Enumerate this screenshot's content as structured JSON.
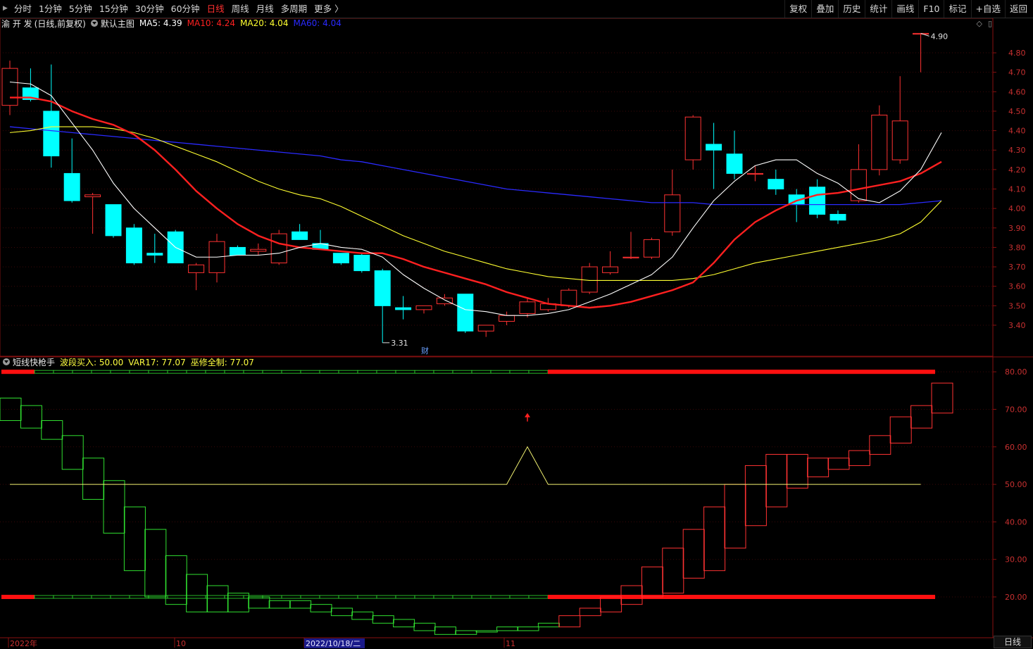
{
  "toolbar": {
    "left": [
      "分时",
      "1分钟",
      "5分钟",
      "15分钟",
      "30分钟",
      "60分钟",
      "日线",
      "周线",
      "月线",
      "多周期",
      "更多 〉"
    ],
    "active": "日线",
    "right": [
      "复权",
      "叠加",
      "历史",
      "统计",
      "画线",
      "F10",
      "标记",
      "+自选",
      "返回"
    ]
  },
  "main_panel": {
    "stock_name": "渝 开 发",
    "mode": "(日线,前复权)",
    "template": "默认主图",
    "ma": [
      {
        "label": "MA5: 4.39",
        "color": "#ffffff"
      },
      {
        "label": "MA10: 4.24",
        "color": "#ff2020"
      },
      {
        "label": "MA20: 4.04",
        "color": "#ffff30"
      },
      {
        "label": "MA60: 4.04",
        "color": "#2a2aff"
      }
    ],
    "high_marker": "4.90",
    "low_marker": "3.31",
    "event_tag": "财",
    "y_ticks": [
      "4.80",
      "4.70",
      "4.60",
      "4.50",
      "4.40",
      "4.30",
      "4.20",
      "4.10",
      "4.00",
      "3.90",
      "3.80",
      "3.70",
      "3.60",
      "3.50",
      "3.40"
    ]
  },
  "sub_panel": {
    "indicator": "短线快枪手",
    "values": [
      {
        "label": "波段买入: 50.00",
        "color": "#ffff40"
      },
      {
        "label": "VAR17: 77.07",
        "color": "#ffff40"
      },
      {
        "label": "巫修全制: 77.07",
        "color": "#ffff40"
      }
    ],
    "y_ticks": [
      "80.00",
      "70.00",
      "60.00",
      "50.00",
      "40.00",
      "30.00",
      "20.00"
    ]
  },
  "x_axis": {
    "labels": [
      "2022年",
      "10",
      "2022/10/18/二",
      "11"
    ],
    "period": "日线"
  },
  "chart_data": {
    "type": "candlestick",
    "candles": [
      {
        "o": 4.53,
        "h": 4.76,
        "l": 4.48,
        "c": 4.72
      },
      {
        "o": 4.62,
        "h": 4.72,
        "l": 4.55,
        "c": 4.56
      },
      {
        "o": 4.5,
        "h": 4.74,
        "l": 4.21,
        "c": 4.27
      },
      {
        "o": 4.18,
        "h": 4.36,
        "l": 4.03,
        "c": 4.04
      },
      {
        "o": 4.06,
        "h": 4.08,
        "l": 3.87,
        "c": 4.07
      },
      {
        "o": 4.02,
        "h": 4.02,
        "l": 3.85,
        "c": 3.86
      },
      {
        "o": 3.9,
        "h": 3.92,
        "l": 3.71,
        "c": 3.72
      },
      {
        "o": 3.77,
        "h": 3.87,
        "l": 3.72,
        "c": 3.76
      },
      {
        "o": 3.88,
        "h": 3.89,
        "l": 3.72,
        "c": 3.72
      },
      {
        "o": 3.67,
        "h": 3.72,
        "l": 3.58,
        "c": 3.71
      },
      {
        "o": 3.67,
        "h": 3.87,
        "l": 3.62,
        "c": 3.83
      },
      {
        "o": 3.8,
        "h": 3.81,
        "l": 3.76,
        "c": 3.76
      },
      {
        "o": 3.78,
        "h": 3.82,
        "l": 3.76,
        "c": 3.79
      },
      {
        "o": 3.72,
        "h": 3.89,
        "l": 3.71,
        "c": 3.87
      },
      {
        "o": 3.88,
        "h": 3.92,
        "l": 3.84,
        "c": 3.84
      },
      {
        "o": 3.82,
        "h": 3.89,
        "l": 3.79,
        "c": 3.79
      },
      {
        "o": 3.77,
        "h": 3.77,
        "l": 3.71,
        "c": 3.72
      },
      {
        "o": 3.76,
        "h": 3.77,
        "l": 3.67,
        "c": 3.68
      },
      {
        "o": 3.68,
        "h": 3.69,
        "l": 3.31,
        "c": 3.5
      },
      {
        "o": 3.49,
        "h": 3.55,
        "l": 3.43,
        "c": 3.48
      },
      {
        "o": 3.48,
        "h": 3.5,
        "l": 3.46,
        "c": 3.5
      },
      {
        "o": 3.51,
        "h": 3.56,
        "l": 3.5,
        "c": 3.54
      },
      {
        "o": 3.56,
        "h": 3.56,
        "l": 3.36,
        "c": 3.37
      },
      {
        "o": 3.37,
        "h": 3.4,
        "l": 3.34,
        "c": 3.4
      },
      {
        "o": 3.42,
        "h": 3.47,
        "l": 3.4,
        "c": 3.45
      },
      {
        "o": 3.46,
        "h": 3.54,
        "l": 3.44,
        "c": 3.52
      },
      {
        "o": 3.48,
        "h": 3.54,
        "l": 3.47,
        "c": 3.51
      },
      {
        "o": 3.5,
        "h": 3.59,
        "l": 3.49,
        "c": 3.58
      },
      {
        "o": 3.57,
        "h": 3.72,
        "l": 3.56,
        "c": 3.7
      },
      {
        "o": 3.67,
        "h": 3.78,
        "l": 3.66,
        "c": 3.7
      },
      {
        "o": 3.75,
        "h": 3.88,
        "l": 3.74,
        "c": 3.75
      },
      {
        "o": 3.75,
        "h": 3.85,
        "l": 3.74,
        "c": 3.84
      },
      {
        "o": 3.88,
        "h": 4.2,
        "l": 3.86,
        "c": 4.07
      },
      {
        "o": 4.25,
        "h": 4.48,
        "l": 4.2,
        "c": 4.47
      },
      {
        "o": 4.33,
        "h": 4.44,
        "l": 4.1,
        "c": 4.3
      },
      {
        "o": 4.28,
        "h": 4.4,
        "l": 4.15,
        "c": 4.18
      },
      {
        "o": 4.18,
        "h": 4.22,
        "l": 4.14,
        "c": 4.18
      },
      {
        "o": 4.15,
        "h": 4.2,
        "l": 4.07,
        "c": 4.1
      },
      {
        "o": 4.07,
        "h": 4.1,
        "l": 3.93,
        "c": 4.02
      },
      {
        "o": 4.11,
        "h": 4.15,
        "l": 3.95,
        "c": 3.97
      },
      {
        "o": 3.97,
        "h": 3.99,
        "l": 3.92,
        "c": 3.94
      },
      {
        "o": 4.04,
        "h": 4.33,
        "l": 4.03,
        "c": 4.2
      },
      {
        "o": 4.2,
        "h": 4.53,
        "l": 4.17,
        "c": 4.48
      },
      {
        "o": 4.25,
        "h": 4.68,
        "l": 4.23,
        "c": 4.45
      },
      {
        "o": 4.9,
        "h": 4.9,
        "l": 4.7,
        "c": 4.9
      }
    ],
    "ma5": [
      4.65,
      4.64,
      4.58,
      4.44,
      4.3,
      4.13,
      4.0,
      3.9,
      3.8,
      3.75,
      3.75,
      3.76,
      3.76,
      3.77,
      3.8,
      3.82,
      3.8,
      3.79,
      3.75,
      3.66,
      3.59,
      3.53,
      3.48,
      3.47,
      3.45,
      3.45,
      3.46,
      3.48,
      3.52,
      3.56,
      3.61,
      3.66,
      3.75,
      3.9,
      4.04,
      4.14,
      4.22,
      4.25,
      4.25,
      4.18,
      4.13,
      4.05,
      4.03,
      4.09,
      4.2,
      4.39
    ],
    "ma10": [
      4.57,
      4.57,
      4.55,
      4.5,
      4.46,
      4.43,
      4.38,
      4.3,
      4.2,
      4.09,
      4.0,
      3.92,
      3.86,
      3.82,
      3.8,
      3.79,
      3.78,
      3.77,
      3.77,
      3.74,
      3.7,
      3.67,
      3.64,
      3.61,
      3.57,
      3.54,
      3.51,
      3.5,
      3.49,
      3.5,
      3.52,
      3.55,
      3.58,
      3.62,
      3.72,
      3.84,
      3.93,
      3.99,
      4.04,
      4.07,
      4.08,
      4.1,
      4.12,
      4.14,
      4.18,
      4.24
    ],
    "ma20": [
      4.39,
      4.4,
      4.42,
      4.42,
      4.42,
      4.41,
      4.39,
      4.36,
      4.32,
      4.28,
      4.24,
      4.19,
      4.14,
      4.1,
      4.07,
      4.05,
      4.01,
      3.96,
      3.91,
      3.86,
      3.82,
      3.78,
      3.75,
      3.72,
      3.69,
      3.67,
      3.65,
      3.64,
      3.63,
      3.63,
      3.63,
      3.63,
      3.63,
      3.64,
      3.66,
      3.69,
      3.72,
      3.74,
      3.76,
      3.78,
      3.8,
      3.82,
      3.84,
      3.87,
      3.93,
      4.04
    ],
    "ma60": [
      4.42,
      4.41,
      4.4,
      4.39,
      4.38,
      4.37,
      4.36,
      4.35,
      4.34,
      4.33,
      4.32,
      4.31,
      4.3,
      4.29,
      4.28,
      4.27,
      4.25,
      4.24,
      4.22,
      4.2,
      4.18,
      4.16,
      4.14,
      4.12,
      4.1,
      4.09,
      4.08,
      4.07,
      4.06,
      4.05,
      4.04,
      4.03,
      4.03,
      4.03,
      4.02,
      4.02,
      4.02,
      4.02,
      4.02,
      4.02,
      4.02,
      4.02,
      4.02,
      4.02,
      4.03,
      4.04
    ],
    "sub_boxes": [
      {
        "a": 73,
        "b": 67
      },
      {
        "a": 71,
        "b": 65
      },
      {
        "a": 67,
        "b": 62
      },
      {
        "a": 63,
        "b": 54
      },
      {
        "a": 57,
        "b": 46
      },
      {
        "a": 51,
        "b": 37
      },
      {
        "a": 44,
        "b": 27
      },
      {
        "a": 38,
        "b": 20
      },
      {
        "a": 31,
        "b": 18
      },
      {
        "a": 26,
        "b": 16
      },
      {
        "a": 23,
        "b": 16
      },
      {
        "a": 21,
        "b": 16
      },
      {
        "a": 20,
        "b": 17
      },
      {
        "a": 19,
        "b": 17
      },
      {
        "a": 19,
        "b": 17
      },
      {
        "a": 18,
        "b": 16
      },
      {
        "a": 17,
        "b": 15
      },
      {
        "a": 16,
        "b": 14
      },
      {
        "a": 15,
        "b": 13
      },
      {
        "a": 14,
        "b": 12
      },
      {
        "a": 13,
        "b": 11
      },
      {
        "a": 12,
        "b": 10
      },
      {
        "a": 11,
        "b": 10
      },
      {
        "a": 11,
        "b": 11
      },
      {
        "a": 12,
        "b": 11
      },
      {
        "a": 12,
        "b": 11
      },
      {
        "a": 13,
        "b": 12
      },
      {
        "a": 15,
        "b": 12
      },
      {
        "a": 17,
        "b": 15
      },
      {
        "a": 20,
        "b": 16
      },
      {
        "a": 23,
        "b": 18
      },
      {
        "a": 28,
        "b": 20
      },
      {
        "a": 33,
        "b": 21
      },
      {
        "a": 38,
        "b": 25
      },
      {
        "a": 44,
        "b": 27
      },
      {
        "a": 50,
        "b": 33
      },
      {
        "a": 55,
        "b": 39
      },
      {
        "a": 58,
        "b": 44
      },
      {
        "a": 58,
        "b": 49
      },
      {
        "a": 57,
        "b": 52
      },
      {
        "a": 57,
        "b": 54
      },
      {
        "a": 59,
        "b": 55
      },
      {
        "a": 63,
        "b": 58
      },
      {
        "a": 68,
        "b": 61
      },
      {
        "a": 71,
        "b": 65
      },
      {
        "a": 77,
        "b": 69
      }
    ],
    "buy_line": {
      "base": 50.0,
      "peak_index": 25,
      "peak": 60.0
    },
    "upper_band": 80.0,
    "lower_band": 20.0,
    "colors": {
      "up": "#ff3232",
      "down": "#00ffff",
      "ma5": "#ffffff",
      "ma10": "#ff2020",
      "ma20": "#ffff30",
      "ma60": "#2a2aff",
      "sub_up": "#ff3232",
      "sub_down": "#30e030"
    }
  }
}
